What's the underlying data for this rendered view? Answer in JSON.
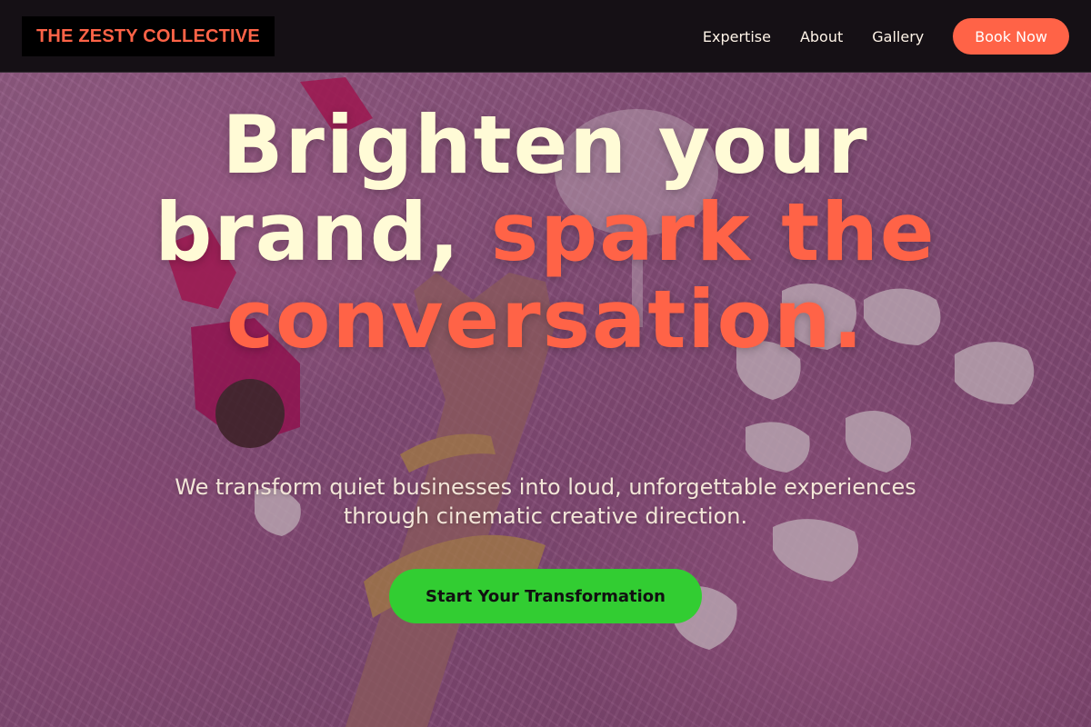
{
  "nav": {
    "brand": "THE ZESTY COLLECTIVE",
    "links": [
      {
        "label": "Expertise"
      },
      {
        "label": "About"
      },
      {
        "label": "Gallery"
      }
    ],
    "cta": "Book Now"
  },
  "hero": {
    "headline_part1": "Brighten your brand, ",
    "headline_accent": "spark the conversation.",
    "subheadline": "We transform quiet businesses into loud, unforgettable experiences through cinematic creative direction.",
    "cta": "Start Your Transformation"
  },
  "colors": {
    "accent": "#ff6347",
    "headline": "#fffbd6",
    "cta_green": "#32cd32",
    "nav_background": "#151015"
  }
}
